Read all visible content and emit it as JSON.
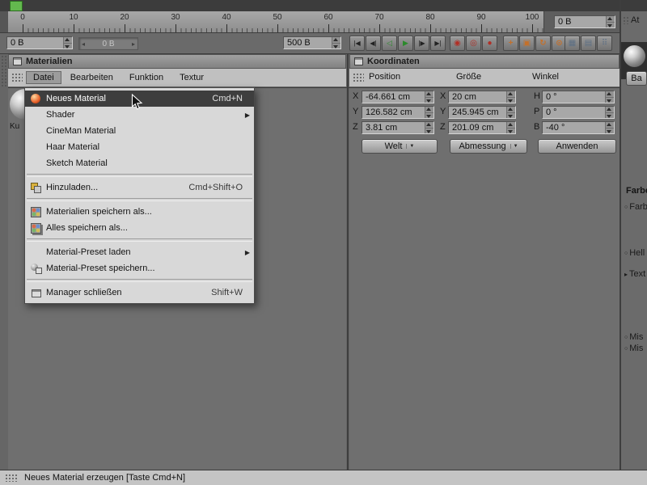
{
  "timeline": {
    "ruler_ticks": [
      "0",
      "10",
      "20",
      "30",
      "40",
      "50",
      "60",
      "70",
      "80",
      "90",
      "100"
    ]
  },
  "toolbar": {
    "frame_start": "0 B",
    "scrub_value": "0 B",
    "frame_end": "500 B",
    "end_display": "0 B",
    "transport": [
      {
        "name": "go-to-start",
        "glyph": "|◀"
      },
      {
        "name": "previous-key",
        "glyph": "◀|"
      },
      {
        "name": "previous-frame",
        "glyph": "◁",
        "green": true
      },
      {
        "name": "play-forwards",
        "glyph": "▶",
        "green": true
      },
      {
        "name": "next-frame",
        "glyph": "|▶"
      },
      {
        "name": "go-to-end",
        "glyph": "▶|"
      }
    ],
    "record_buttons": [
      {
        "name": "record-keyframe",
        "glyph": "◉"
      },
      {
        "name": "autokeying",
        "glyph": "◎"
      },
      {
        "name": "record-settings",
        "glyph": "●"
      }
    ],
    "toggle_buttons": [
      {
        "name": "keyframe-position-toggle",
        "glyph": "+"
      },
      {
        "name": "keyframe-scale-toggle",
        "glyph": "▣"
      },
      {
        "name": "keyframe-rotation-toggle",
        "glyph": "↻"
      },
      {
        "name": "keyframe-parameter-toggle",
        "glyph": "⊙"
      }
    ],
    "snap_buttons": [
      {
        "name": "snap-toggle",
        "glyph": "▦"
      },
      {
        "name": "grid-toggle",
        "glyph": "▤"
      },
      {
        "name": "quantize-toggle",
        "glyph": "⠿"
      }
    ]
  },
  "materials_panel": {
    "title": "Materialien",
    "menus": [
      "Datei",
      "Bearbeiten",
      "Funktion",
      "Textur"
    ],
    "thumbnail_label": "Ku"
  },
  "file_menu": {
    "items": [
      {
        "label": "Neues Material",
        "shortcut": "Cmd+N",
        "icon": "material",
        "highlighted": true
      },
      {
        "label": "Shader",
        "submenu": true
      },
      {
        "label": "CineMan Material"
      },
      {
        "label": "Haar Material"
      },
      {
        "label": "Sketch Material"
      },
      {
        "separator": true
      },
      {
        "label": "Hinzuladen...",
        "shortcut": "Cmd+Shift+O",
        "icon": "load"
      },
      {
        "separator": true
      },
      {
        "label": "Materialien speichern als...",
        "icon": "save"
      },
      {
        "label": "Alles speichern als...",
        "icon": "saveall"
      },
      {
        "separator": true
      },
      {
        "label": "Material-Preset laden",
        "submenu": true
      },
      {
        "label": "Material-Preset speichern...",
        "icon": "preset"
      },
      {
        "separator": true
      },
      {
        "label": "Manager schließen",
        "shortcut": "Shift+W",
        "icon": "window"
      }
    ]
  },
  "coordinates_panel": {
    "title": "Koordinaten",
    "columns": [
      "Position",
      "Größe",
      "Winkel"
    ],
    "position": [
      {
        "axis": "X",
        "value": "-64.661 cm"
      },
      {
        "axis": "Y",
        "value": "126.582 cm"
      },
      {
        "axis": "Z",
        "value": "3.81 cm"
      }
    ],
    "size": [
      {
        "axis": "X",
        "value": "20 cm"
      },
      {
        "axis": "Y",
        "value": "245.945 cm"
      },
      {
        "axis": "Z",
        "value": "201.09 cm"
      }
    ],
    "angle": [
      {
        "axis": "H",
        "value": "0 °"
      },
      {
        "axis": "P",
        "value": "0 °"
      },
      {
        "axis": "B",
        "value": "-40 °"
      }
    ],
    "world_dropdown": "Welt",
    "dimension_dropdown": "Abmessung",
    "apply_button": "Anwenden"
  },
  "attributes_panel": {
    "header": "At",
    "tab": "Ba",
    "section_label": "Farbe",
    "items": [
      {
        "label": "Farb"
      },
      {
        "label": "Hell"
      },
      {
        "label": "Text"
      },
      {
        "label": "Mis"
      },
      {
        "label": "Mis"
      }
    ]
  },
  "status_bar": {
    "text": "Neues Material erzeugen [Taste Cmd+N]"
  }
}
